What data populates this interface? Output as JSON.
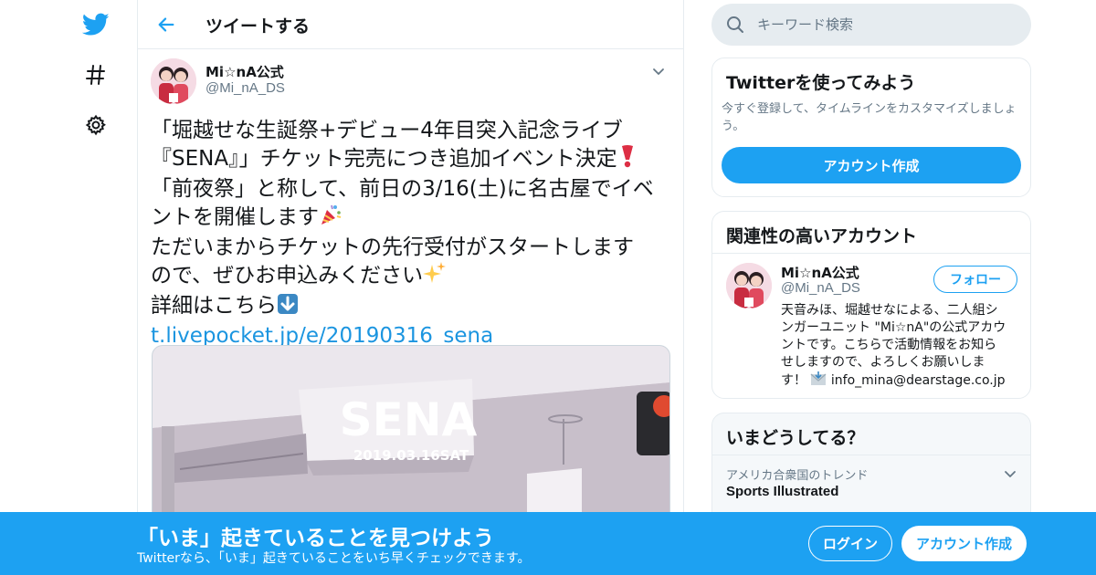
{
  "header": {
    "title": "ツイートする"
  },
  "tweet": {
    "author_name": "Mi☆nA公式",
    "author_handle": "@Mi_nA_DS",
    "lines": [
      "「堀越せな生誕祭+デビュー4年目突入記念ライブ",
      "『SENA』」チケット完売につき追加イベント決定",
      "「前夜祭」と称して、前日の3/16(土)に名古屋でイベ",
      "ントを開催します",
      "ただいまからチケットの先行受付がスタートします",
      "ので、ぜひお申込みください",
      "詳細はこちら"
    ],
    "link": "t.livepocket.jp/e/20190316_sena",
    "media_title": "SENA",
    "media_date": "2019.03.16SAT"
  },
  "search": {
    "placeholder": "キーワード検索"
  },
  "signup_card": {
    "title": "Twitterを使ってみよう",
    "description": "今すぐ登録して、タイムラインをカスタマイズしましょう。",
    "button": "アカウント作成"
  },
  "related": {
    "title": "関連性の高いアカウント",
    "name": "Mi☆nA公式",
    "handle": "@Mi_nA_DS",
    "follow": "フォロー",
    "bio_lines": [
      "天音みほ、堀越せなによる、二人組シ",
      "ンガーユニット \"Mi☆nA\"の公式アカウ",
      "ントです。こちらで活動情報をお知ら",
      "せしますので、よろしくお願いしま",
      "す！ "
    ],
    "bio_email": "info_mina@dearstage.co.jp"
  },
  "trends": {
    "title": "いまどうしてる？",
    "context": "アメリカ合衆国のトレンド",
    "name": "Sports Illustrated"
  },
  "bottom_bar": {
    "title": "「いま」起きていることを見つけよう",
    "subtitle": "Twitterなら、「いま」起きていることをいち早くチェックできます。",
    "login": "ログイン",
    "signup": "アカウント作成"
  },
  "colors": {
    "accent": "#1da1f2",
    "link": "#1b95e0",
    "secondary_text": "#657786",
    "border": "#e6ecf0"
  },
  "icons": [
    "twitter-bird-icon",
    "hashtag-icon",
    "gear-icon",
    "back-arrow-icon",
    "chevron-down-icon",
    "search-icon",
    "heavy-exclamation-emoji",
    "party-popper-emoji",
    "sparkles-emoji",
    "down-arrow-emoji",
    "envelope-emoji"
  ]
}
